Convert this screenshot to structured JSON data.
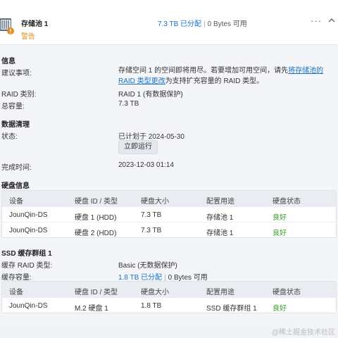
{
  "header": {
    "title": "存储池 1",
    "status": "警告",
    "capacity_allocated": "7.3 TB 已分配",
    "capacity_separator": "|",
    "capacity_available": "0 Bytes 可用",
    "more_label": "···",
    "icon_names": [
      "storage-pool-icon",
      "warning-badge-icon",
      "more-icon",
      "chevron-up-icon"
    ]
  },
  "info": {
    "title": "信息",
    "suggestion_label": "建议事项:",
    "suggestion_text_1": "存储空间 1 的空间即将用尽。若要增加可用空间，请先",
    "suggestion_link": "将存储池的 RAID 类型更改",
    "suggestion_text_2": "为支持扩充容量的 RAID 类型。",
    "raid_label": "RAID 类别:",
    "raid_value": "RAID 1 (有数据保护)",
    "total_label": "总容量:",
    "total_value": "7.3 TB"
  },
  "scrub": {
    "title": "数据清理",
    "status_label": "状态:",
    "status_value": "已计划于 2024-05-30",
    "run_now_label": "立即运行",
    "completed_label": "完成时间:",
    "completed_value": "2023-12-03 01:14"
  },
  "disk_info": {
    "title": "硬盘信息",
    "columns": [
      "设备",
      "硬盘 ID / 类型",
      "硬盘大小",
      "配置用途",
      "硬盘状态"
    ],
    "rows": [
      [
        "JounQin-DS",
        "硬盘 1 (HDD)",
        "7.3 TB",
        "存储池 1",
        "良好"
      ],
      [
        "JounQin-DS",
        "硬盘 2 (HDD)",
        "7.3 TB",
        "存储池 1",
        "良好"
      ]
    ]
  },
  "ssd_cache": {
    "title": "SSD 缓存群组 1",
    "raid_label": "缓存 RAID 类型:",
    "raid_value": "Basic (无数据保护)",
    "capacity_label": "缓存容量:",
    "capacity_allocated": "1.8 TB 已分配",
    "capacity_separator": "|",
    "capacity_available": "0 Bytes 可用",
    "columns": [
      "设备",
      "硬盘 ID / 类型",
      "硬盘大小",
      "配置用途",
      "硬盘状态"
    ],
    "rows": [
      [
        "JounQin-DS",
        "M.2 硬盘 1",
        "1.8 TB",
        "SSD 缓存群组 1",
        "良好"
      ]
    ]
  },
  "watermark": "@稀土掘金技术社区",
  "colors": {
    "accent": "#1a73c8",
    "warning": "#e88a1a",
    "good": "#3a9e2a",
    "table_header": "#e9edf2"
  }
}
